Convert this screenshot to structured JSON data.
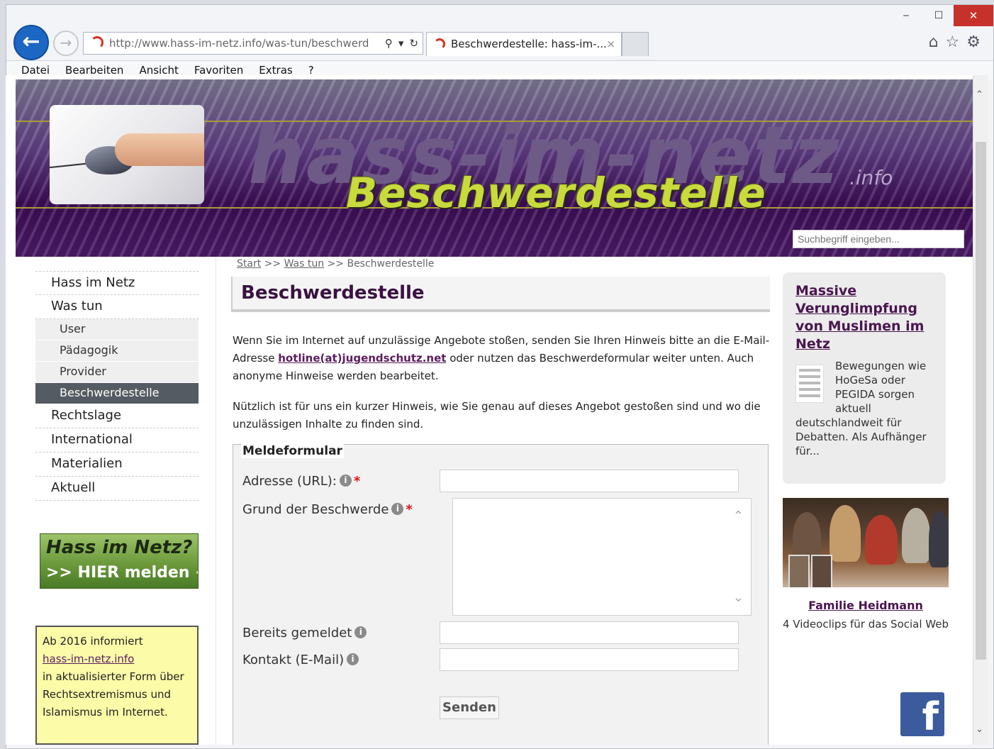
{
  "browser": {
    "url": "http://www.hass-im-netz.info/was-tun/beschwerd",
    "tab_title": "Beschwerdestelle: hass-im-...",
    "tab_close": "×",
    "win_min": "‒",
    "win_max": "☐",
    "win_close": "✕",
    "icons": [
      "home-icon",
      "star-icon",
      "gear-icon"
    ],
    "menu": [
      "Datei",
      "Bearbeiten",
      "Ansicht",
      "Favoriten",
      "Extras",
      "?"
    ]
  },
  "banner": {
    "brand": "hass-im-netz",
    "brand_suffix": ".info",
    "subtitle": "Beschwerdestelle",
    "search_placeholder": "Suchbegriff eingeben..."
  },
  "leftnav": {
    "main_1": "Hass im Netz",
    "main_2": "Was tun",
    "sub": [
      "User",
      "Pädagogik",
      "Provider",
      "Beschwerdestelle"
    ],
    "main_3": "Rechtslage",
    "main_4": "International",
    "main_5": "Materialien",
    "main_6": "Aktuell"
  },
  "report_banner": {
    "line1": "Hass im Netz?",
    "line2": ">> HIER melden <<"
  },
  "info_box": {
    "line1": "Ab 2016 informiert",
    "link": "hass-im-netz.info",
    "line2": "in aktualisierter Form über Rechtsextremismus und Islamismus im Internet."
  },
  "breadcrumb": {
    "start": "Start",
    "sep": ">>",
    "was_tun": "Was tun",
    "current": "Beschwerdestelle"
  },
  "main": {
    "title": "Beschwerdestelle",
    "p1_a": "Wenn Sie im Internet auf unzulässige Angebote stoßen, senden Sie Ihren Hinweis bitte an die E-Mail-Adresse ",
    "p1_link": "hotline(at)jugendschutz.net",
    "p1_b": " oder nutzen das Beschwerdeformular weiter unten. Auch anonyme Hinweise werden bearbeitet.",
    "p2": "Nützlich ist für uns ein kurzer Hinweis, wie Sie genau auf dieses Angebot gestoßen sind und wo die unzulässigen Inhalte zu finden sind."
  },
  "form": {
    "legend": "Meldeformular",
    "url_label": "Adresse (URL):",
    "reason_label": "Grund der Beschwerde",
    "reported_label": "Bereits gemeldet",
    "contact_label": "Kontakt (E-Mail)",
    "required_mark": "*",
    "info_glyph": "i",
    "submit": "Senden"
  },
  "right": {
    "news_title": "Massive Verunglimpfung von Muslimen im Netz",
    "news_text_indent": "Bewegungen wie HoGeSa oder PEGIDA sorgen aktuell",
    "news_text_rest": "deutschlandweit für Debatten. Als Aufhänger für...",
    "video_title": "Familie Heidmann",
    "video_sub": "4 Videoclips für das Social Web",
    "fb_glyph": "f"
  }
}
